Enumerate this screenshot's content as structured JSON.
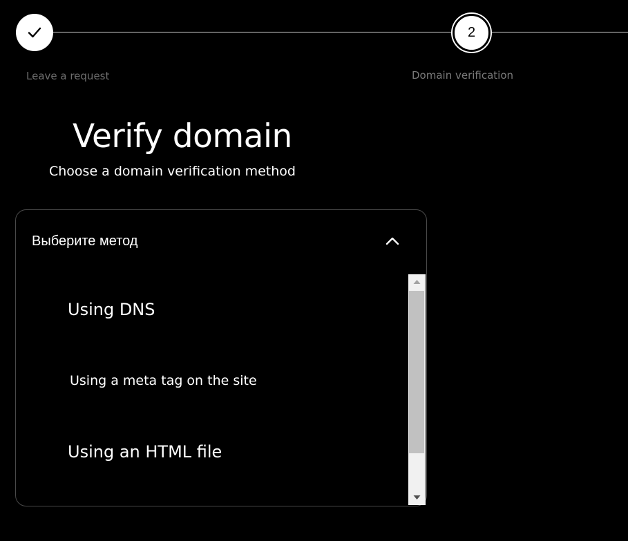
{
  "stepper": {
    "steps": [
      {
        "label": "Leave a request",
        "state": "completed",
        "icon": "checkmark-icon"
      },
      {
        "label": "Domain verification",
        "number": "2",
        "state": "active"
      }
    ]
  },
  "heading": {
    "title": "Verify domain",
    "subtitle": "Choose a domain verification method"
  },
  "method_select": {
    "selected_value": "Выберите метод",
    "expanded": true,
    "toggle_icon": "chevron-up-icon",
    "options": [
      {
        "label": "Using DNS"
      },
      {
        "label": "Using a meta tag on the site"
      },
      {
        "label": "Using an HTML file"
      }
    ]
  },
  "colors": {
    "background": "#000000",
    "text": "#ffffff",
    "muted_text": "#6e6e6e",
    "border": "#4a4a4a",
    "scrollbar_track": "#f1f1f1",
    "scrollbar_thumb": "#c1c1c1"
  }
}
